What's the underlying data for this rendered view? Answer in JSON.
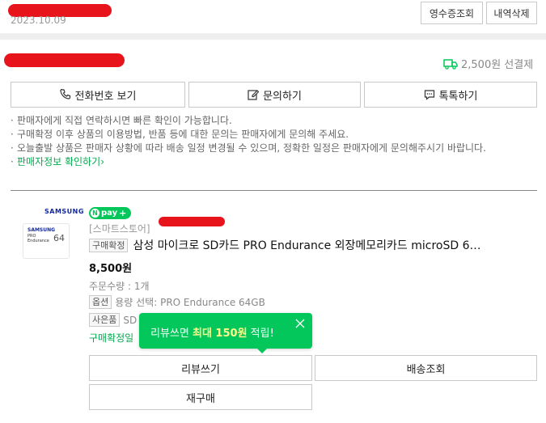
{
  "order": {
    "date": "2023.10.09",
    "receipt_button": "영수증조회",
    "delete_button": "내역삭제"
  },
  "shipping": {
    "fee_text": "2,500원 선결제",
    "contact_buttons": [
      "전화번호 보기",
      "문의하기",
      "톡톡하기"
    ]
  },
  "notes": [
    "판매자에게 직접 연락하시면 빠른 확인이 가능합니다.",
    "구매확정 이후 상품의 이용방법, 반품 등에 대한 문의는 판매자에게 문의해 주세요.",
    "오늘출발 상품은 판매자 상황에 따라 배송 일정 변경될 수 있으며, 정확한 일정은 판매자에게 문의해주시기 바랍니다."
  ],
  "seller_info_link": "판매자정보 확인하기",
  "product": {
    "brand_logo": "SAMSUNG",
    "image_brand": "SAMSUNG",
    "image_line1": "PRO",
    "image_line2": "Endurance",
    "image_capacity": "64",
    "npay_badge": "pay",
    "store_label": "[스마트스토어]",
    "status_tag": "구매확정",
    "title": "삼성 마이크로 SD카드 PRO Endurance 외장메모리카드 microSD 6…",
    "price": "8,500원",
    "quantity_text": "주문수량 : 1개",
    "option_tag": "옵션",
    "option_text": "용량 선택: PRO Endurance 64GB",
    "gift_tag": "사은품",
    "gift_text": "SD",
    "confirm_text": "구매확정일"
  },
  "tooltip": {
    "prefix": "리뷰쓰면 ",
    "highlight": "최대 150원",
    "suffix": " 적립!"
  },
  "actions": {
    "review": "리뷰쓰기",
    "tracking": "배송조회",
    "rebuy": "재구매"
  },
  "colors": {
    "accent_green": "#03c75a",
    "redaction": "#e8141c"
  }
}
